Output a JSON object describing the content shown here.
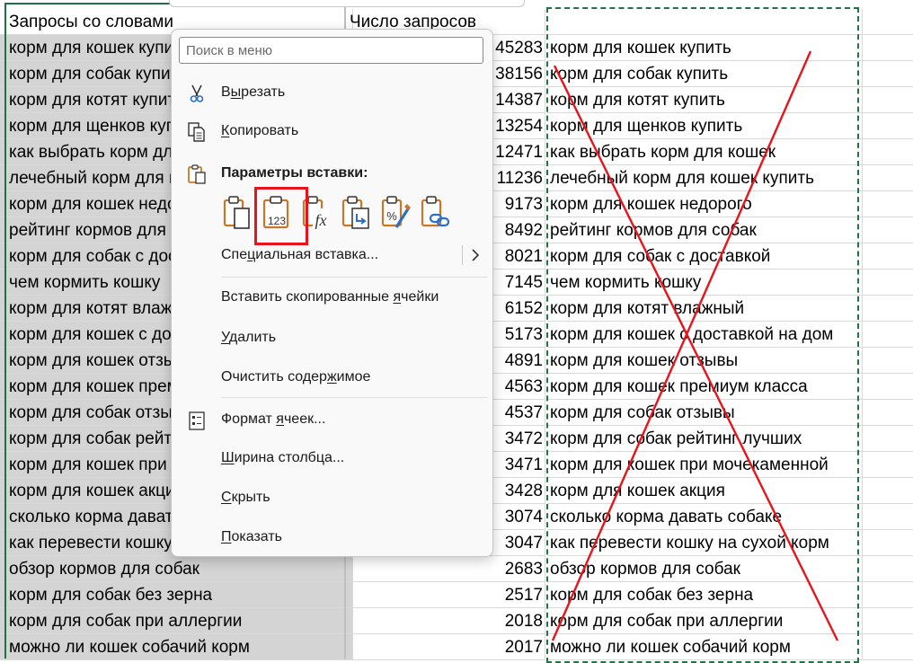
{
  "sheet": {
    "header": {
      "col_a": "Запросы со словами",
      "col_b": "Число запросов"
    },
    "rows": [
      {
        "a": "корм для кошек купить",
        "b": "45283",
        "c": "корм для кошек купить"
      },
      {
        "a": "корм для собак купить",
        "b": "38156",
        "c": "корм для собак купить"
      },
      {
        "a": "корм для котят купить",
        "b": "14387",
        "c": "корм для котят купить"
      },
      {
        "a": "корм для щенков купить",
        "b": "13254",
        "c": "корм для щенков купить"
      },
      {
        "a": "как выбрать корм для кошек",
        "b": "12471",
        "c": "как выбрать корм для кошек"
      },
      {
        "a": "лечебный корм для кошек купить",
        "b": "11236",
        "c": "лечебный корм для кошек купить"
      },
      {
        "a": "корм для кошек недорого",
        "b": "9173",
        "c": "корм для кошек недорого"
      },
      {
        "a": "рейтинг кормов для собак",
        "b": "8492",
        "c": "рейтинг кормов для собак"
      },
      {
        "a": "корм для собак с доставкой",
        "b": "8021",
        "c": "корм для собак с доставкой"
      },
      {
        "a": "чем кормить кошку",
        "b": "7145",
        "c": "чем кормить кошку"
      },
      {
        "a": "корм для котят влажный",
        "b": "6152",
        "c": "корм для котят влажный"
      },
      {
        "a": "корм для кошек с доставкой на дом",
        "b": "5173",
        "c": "корм для кошек с доставкой на дом"
      },
      {
        "a": "корм для кошек отзывы",
        "b": "4891",
        "c": "корм для кошек отзывы"
      },
      {
        "a": "корм для кошек премиум класса",
        "b": "4563",
        "c": "корм для кошек премиум класса"
      },
      {
        "a": "корм для собак отзывы",
        "b": "4537",
        "c": "корм для собак отзывы"
      },
      {
        "a": "корм для собак рейтинг лучших",
        "b": "3472",
        "c": "корм для собак рейтинг лучших"
      },
      {
        "a": "корм для кошек при мочекаменной",
        "b": "3471",
        "c": "корм для кошек при мочекаменной"
      },
      {
        "a": "корм для кошек акция",
        "b": "3428",
        "c": "корм для кошек акция"
      },
      {
        "a": "сколько корма давать собаке",
        "b": "3074",
        "c": "сколько корма давать собаке"
      },
      {
        "a": "как перевести кошку на сухой корм",
        "b": "3047",
        "c": "как перевести кошку на сухой корм"
      },
      {
        "a": "обзор кормов для собак",
        "b": "2683",
        "c": "обзор кормов для собак"
      },
      {
        "a": "корм для собак без зерна",
        "b": "2517",
        "c": "корм для собак без зерна"
      },
      {
        "a": "корм для собак при аллергии",
        "b": "2018",
        "c": "корм для собак при аллергии"
      },
      {
        "a": "можно ли кошек собачий корм",
        "b": "2017",
        "c": "можно ли кошек собачий корм"
      }
    ]
  },
  "context_menu": {
    "search_placeholder": "Поиск в меню",
    "cut": {
      "pre": "В",
      "u": "ы",
      "post": "резать",
      "icon": "scissors-icon"
    },
    "copy": {
      "pre": "",
      "u": "К",
      "post": "опировать",
      "icon": "copy-icon"
    },
    "paste_options_label": "Параметры вставки:",
    "paste_buttons": [
      {
        "name": "paste-button",
        "icon": "clipboard-paste-icon"
      },
      {
        "name": "paste-values-button",
        "icon": "clipboard-values-icon",
        "badge": "123",
        "highlighted": true
      },
      {
        "name": "paste-formulas-button",
        "icon": "clipboard-formulas-icon",
        "badge": "fx"
      },
      {
        "name": "paste-transpose-button",
        "icon": "clipboard-transpose-icon"
      },
      {
        "name": "paste-formatting-button",
        "icon": "clipboard-format-icon"
      },
      {
        "name": "paste-link-button",
        "icon": "clipboard-link-icon"
      }
    ],
    "special_paste": {
      "pre": "Спе",
      "u": "ц",
      "post": "иальная вставка..."
    },
    "insert_copied": {
      "pre": "Вставить скопированные ",
      "u": "я",
      "post": "чейки"
    },
    "delete": {
      "pre": "",
      "u": "У",
      "post": "далить"
    },
    "clear": {
      "pre": "Очистить содер",
      "u": "ж",
      "post": "имое"
    },
    "format_cells": {
      "pre": "Формат ",
      "u": "я",
      "post": "чеек...",
      "icon": "format-cells-icon"
    },
    "column_width": {
      "pre": "",
      "u": "Ш",
      "post": "ирина столбца..."
    },
    "hide": {
      "pre": "",
      "u": "С",
      "post": "крыть"
    },
    "show": {
      "pre": "",
      "u": "П",
      "post": "оказать"
    }
  },
  "colors": {
    "selection_green": "#1e7145",
    "annotation_red": "#e8141c",
    "clipboard_orange": "#c8782a",
    "icon_blue": "#2e6fc3"
  }
}
